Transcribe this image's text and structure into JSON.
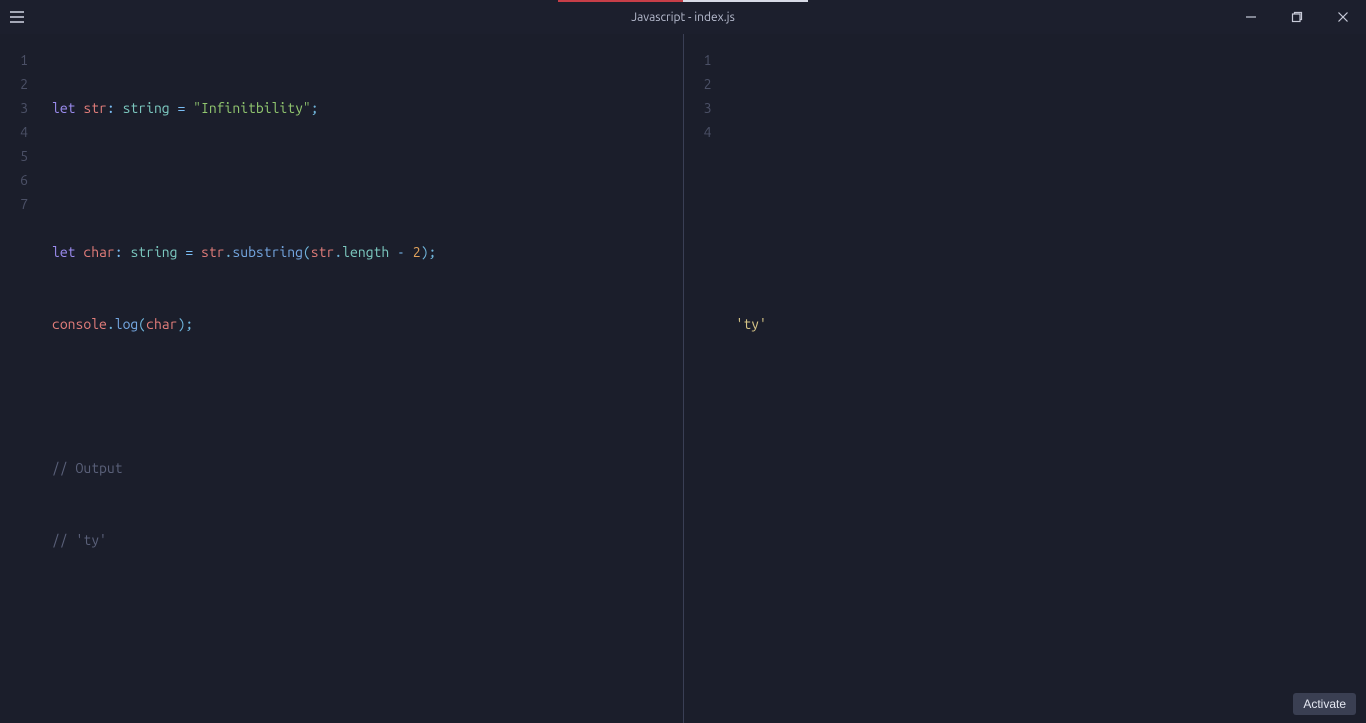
{
  "window": {
    "title": "Javascript - index.js"
  },
  "left_pane": {
    "line_numbers": [
      "1",
      "2",
      "3",
      "4",
      "5",
      "6",
      "7"
    ],
    "lines": {
      "l1": {
        "kw_let": "let",
        "var_str": "str",
        "colon": ": ",
        "type": "string",
        "eq": " = ",
        "str_lit": "\"Infinitbility\"",
        "semi": ";"
      },
      "l3": {
        "kw_let": "let",
        "var_char": "char",
        "colon": ": ",
        "type": "string",
        "eq": " = ",
        "var_str": "str",
        "dot1": ".",
        "fn_sub": "substring",
        "paren_o": "(",
        "var_str2": "str",
        "dot2": ".",
        "prop_len": "length",
        "minus": " - ",
        "num": "2",
        "paren_c": ")",
        "semi": ";"
      },
      "l4": {
        "obj_console": "console",
        "dot": ".",
        "fn_log": "log",
        "paren_o": "(",
        "var_char": "char",
        "paren_c": ")",
        "semi": ";"
      },
      "l6": {
        "comment": "// Output"
      },
      "l7": {
        "comment": "// 'ty'"
      }
    }
  },
  "right_pane": {
    "line_numbers": [
      "1",
      "2",
      "3",
      "4"
    ],
    "lines": {
      "l4": {
        "out": "'ty'"
      }
    }
  },
  "footer": {
    "activate_label": "Activate"
  }
}
